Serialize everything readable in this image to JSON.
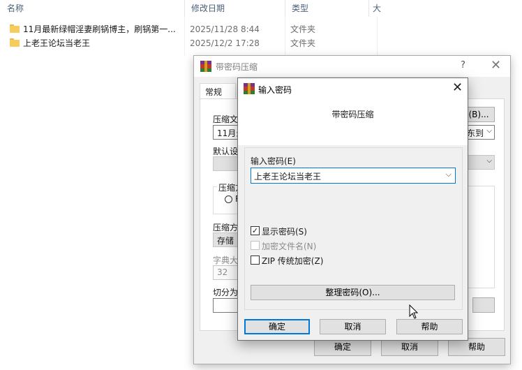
{
  "explorer": {
    "columns": {
      "name": "名称",
      "date": "修改日期",
      "type": "类型",
      "extra": "大"
    },
    "rows": [
      {
        "name": "11月最新绿帽淫妻刷锅博主，刷锅第一...",
        "date": "2025/11/28 8:44",
        "type": "文件夹"
      },
      {
        "name": "上老王论坛当老王",
        "date": "2025/12/2 17:28",
        "type": "文件夹"
      }
    ]
  },
  "back_dialog": {
    "title": "带密码压缩",
    "help": "?",
    "close": "✕",
    "tab_general": "常规",
    "archive_name_label": "压缩文",
    "archive_name_value": "11月最",
    "browse_button": "(B)...",
    "update_mode_value": "东到",
    "default_profile_label": "默认设",
    "format_group_label": "压缩方",
    "format_option": "R",
    "method_label": "压缩方",
    "method_value": "存储",
    "dict_label": "字典大",
    "dict_value": "32",
    "split_label": "切分为",
    "ok": "确定",
    "cancel": "取消",
    "help_button": "帮助"
  },
  "password_dialog": {
    "title": "输入密码",
    "close": "✕",
    "heading": "带密码压缩",
    "password_label": "输入密码(E)",
    "password_value": "上老王论坛当老王",
    "show_password": {
      "label": "显示密码(S)",
      "checked": true
    },
    "encrypt_names": {
      "label": "加密文件名(N)",
      "checked": false,
      "disabled": true
    },
    "zip_legacy": {
      "label": "ZIP 传统加密(Z)",
      "checked": false
    },
    "organize_button": "整理密码(O)...",
    "ok": "确定",
    "cancel": "取消",
    "help": "帮助"
  },
  "icons": {
    "folder": "folder-icon",
    "app": "winrar-icon",
    "dropdown": "chevron-down-icon"
  }
}
